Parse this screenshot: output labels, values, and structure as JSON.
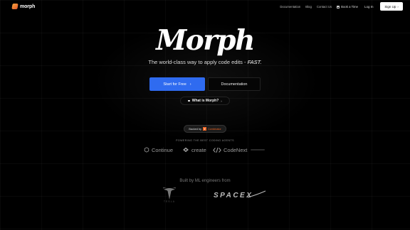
{
  "nav": {
    "brand": "morph",
    "links": [
      "Documentation",
      "Blog",
      "Contact Us"
    ],
    "book_label": "Book a Time",
    "login_label": "Log In",
    "signup_label": "Sign Up",
    "signup_icon": "chevron-right-icon"
  },
  "hero": {
    "title": "Morph",
    "tagline_prefix": "The world-class way to apply code edits - ",
    "tagline_emphasis": "FAST.",
    "primary_cta": "Start for Free",
    "secondary_cta": "Documentation",
    "pill_label": "What is Morph?"
  },
  "backed": {
    "prefix": "Backed by",
    "badge": "Y",
    "name": "Combinator"
  },
  "agents": {
    "heading": "POWERING THE BEST CODING AGENTS",
    "items": [
      "Continue",
      "create",
      "CodeNext"
    ]
  },
  "built": {
    "heading": "Built by ML engineers from",
    "companies": [
      "TESLA",
      "SPACEX"
    ]
  },
  "colors": {
    "background": "#000000",
    "primary_button": "#2f6bf0",
    "yc_orange": "#f26522"
  }
}
